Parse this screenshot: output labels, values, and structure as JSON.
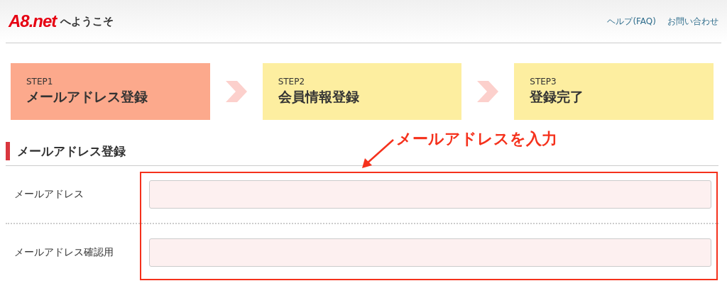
{
  "header": {
    "logo": "A8.net",
    "welcome": "へようこそ",
    "links": [
      "ヘルプ(FAQ)",
      "お問い合わせ"
    ]
  },
  "steps": [
    {
      "number": "STEP1",
      "label": "メールアドレス登録",
      "selected": true
    },
    {
      "number": "STEP2",
      "label": "会員情報登録",
      "selected": false
    },
    {
      "number": "STEP3",
      "label": "登録完了",
      "selected": false
    }
  ],
  "section": {
    "title": "メールアドレス登録"
  },
  "annotation": {
    "text": "メールアドレスを入力"
  },
  "fields": [
    {
      "label": "メールアドレス"
    },
    {
      "label": "メールアドレス確認用"
    }
  ]
}
